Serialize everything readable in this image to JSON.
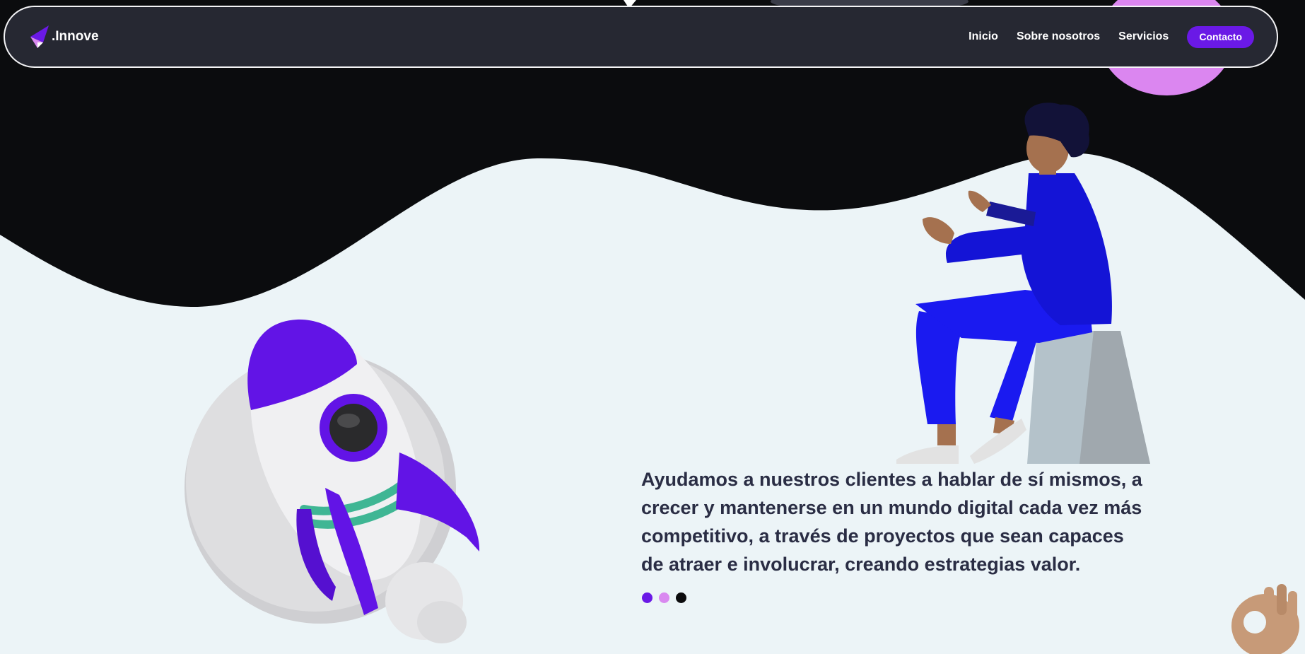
{
  "brand": {
    "name": ".Innove"
  },
  "nav": {
    "links": [
      "Inicio",
      "Sobre nosotros",
      "Servicios"
    ],
    "contact": "Contacto"
  },
  "hero": {
    "headline": "Ayudamos a nuestros clientes a hablar de sí mismos, a crecer y mantenerse en un mundo digital cada vez más competitivo, a través de proyectos que sean capaces de atraer e involucrar, creando estrategias valor."
  },
  "carousel": {
    "dot_colors": [
      "#6a19e6",
      "#d989f0",
      "#0b0b0d"
    ],
    "active_index": 0
  },
  "colors": {
    "dark_bg": "#0b0c0e",
    "light_bg": "#ecf4f7",
    "nav_bg": "#262832",
    "accent": "#6a19e6",
    "pink": "#db86f0",
    "text": "#2a2d44"
  },
  "icons": [
    "logo-icon",
    "rocket-illustration",
    "person-sitting-illustration",
    "ok-hand-emoji"
  ]
}
